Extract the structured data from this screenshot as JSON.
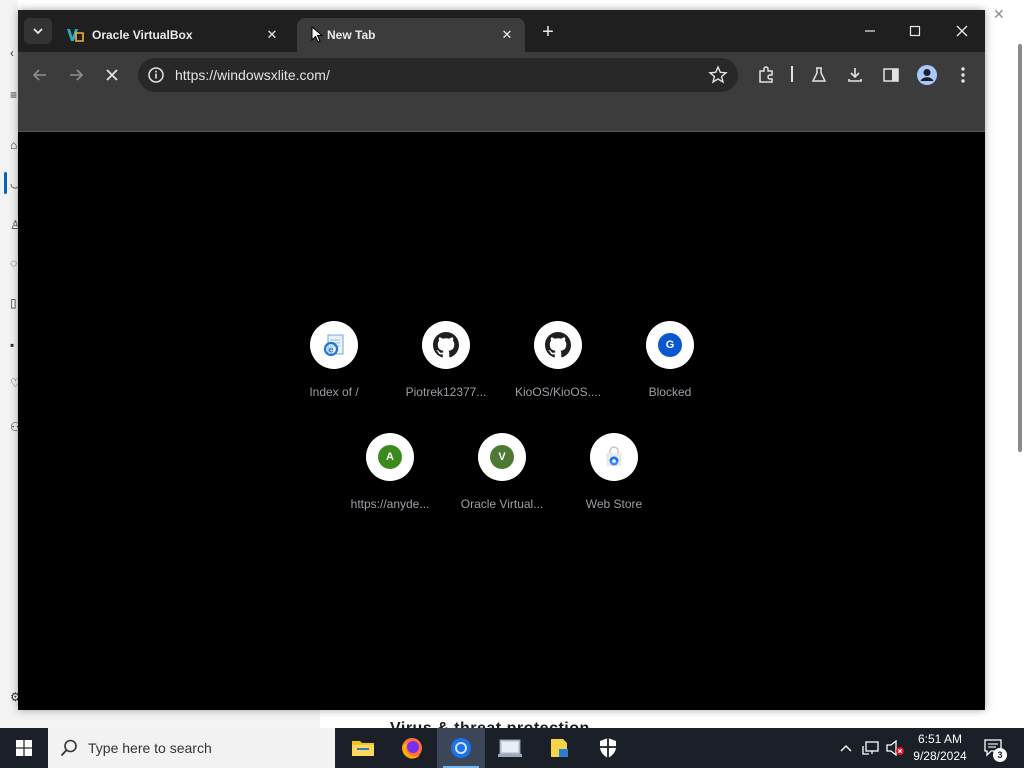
{
  "browser": {
    "tabs": [
      {
        "title": "Oracle VirtualBox",
        "active": false
      },
      {
        "title": "New Tab",
        "active": true
      }
    ],
    "url": "https://windowsxlite.com/",
    "shortcuts": [
      {
        "label": "Index of /",
        "icon": "ie-document-icon"
      },
      {
        "label": "Piotrek12377...",
        "icon": "github-icon"
      },
      {
        "label": "KioOS/KioOS....",
        "icon": "github-icon"
      },
      {
        "label": "Blocked",
        "icon": "letter-avatar-icon",
        "letter": "G",
        "color": "#0b57d0"
      },
      {
        "label": "https://anyde...",
        "icon": "letter-avatar-icon",
        "letter": "A",
        "color": "#3b8a1e"
      },
      {
        "label": "Oracle Virtual...",
        "icon": "letter-avatar-icon",
        "letter": "V",
        "color": "#4d7a32"
      },
      {
        "label": "Web Store",
        "icon": "web-store-icon"
      }
    ]
  },
  "background_window": {
    "partial_text": "Virus & threat protection"
  },
  "taskbar": {
    "search_placeholder": "Type here to search",
    "apps": [
      {
        "name": "file-explorer-icon"
      },
      {
        "name": "firefox-icon"
      },
      {
        "name": "chrome-icon",
        "active": true
      },
      {
        "name": "virtualbox-icon"
      },
      {
        "name": "notes-icon"
      },
      {
        "name": "security-shield-icon"
      }
    ],
    "time": "6:51 AM",
    "date": "9/28/2024",
    "notification_count": "3"
  }
}
